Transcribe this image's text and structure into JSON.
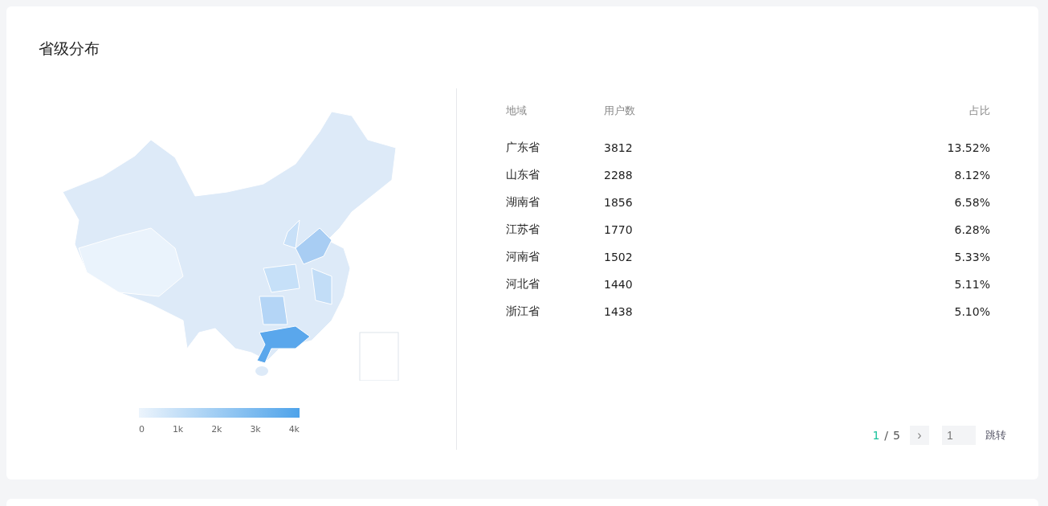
{
  "card": {
    "title": "省级分布"
  },
  "legend": {
    "ticks": [
      "0",
      "1k",
      "2k",
      "3k",
      "4k"
    ]
  },
  "table": {
    "columns": [
      "地域",
      "用户数",
      "占比"
    ],
    "rows": [
      {
        "region": "广东省",
        "users": "3812",
        "share": "13.52%"
      },
      {
        "region": "山东省",
        "users": "2288",
        "share": "8.12%"
      },
      {
        "region": "湖南省",
        "users": "1856",
        "share": "6.58%"
      },
      {
        "region": "江苏省",
        "users": "1770",
        "share": "6.28%"
      },
      {
        "region": "河南省",
        "users": "1502",
        "share": "5.33%"
      },
      {
        "region": "河北省",
        "users": "1440",
        "share": "5.11%"
      },
      {
        "region": "浙江省",
        "users": "1438",
        "share": "5.10%"
      }
    ]
  },
  "pagination": {
    "current": "1",
    "separator": "/",
    "total": "5",
    "next": "›",
    "jump_placeholder": "1",
    "jump_label": "跳转"
  }
}
